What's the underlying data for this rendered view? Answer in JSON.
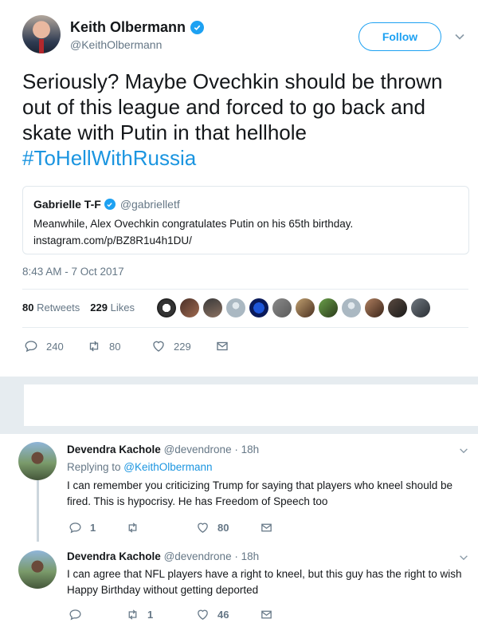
{
  "main_tweet": {
    "author_name": "Keith Olbermann",
    "author_handle": "@KeithOlbermann",
    "follow_label": "Follow",
    "text_lines": [
      "Seriously? Maybe Ovechkin should be thrown",
      "out of this league and forced to go back and",
      "skate with Putin in that hellhole"
    ],
    "hashtag": "#ToHellWithRussia",
    "quote": {
      "author_name": "Gabrielle T-F",
      "author_handle": "@gabrielletf",
      "text": "Meanwhile, Alex Ovechkin congratulates Putin on his 65th birthday.",
      "link": "instagram.com/p/BZ8R1u4h1DU/"
    },
    "timestamp": "8:43 AM - 7 Oct 2017",
    "retweets_count": "80",
    "retweets_label": "Retweets",
    "likes_count": "229",
    "likes_label": "Likes",
    "actions": {
      "replies": "240",
      "retweets": "80",
      "likes": "229"
    }
  },
  "replies": [
    {
      "author_name": "Devendra Kachole",
      "meta": "@devendrone · 18h",
      "replying_prefix": "Replying to ",
      "replying_to": "@KeithOlbermann",
      "text": "I can remember you criticizing Trump for saying that players who kneel should be fired. This is hypocrisy. He has Freedom of Speech too",
      "replies": "1",
      "retweets": "",
      "likes": "80"
    },
    {
      "author_name": "Devendra Kachole",
      "meta": "@devendrone · 18h",
      "text": "I can agree that NFL players have a right to kneel, but this guy has the right to wish Happy Birthday without getting deported",
      "replies": "",
      "retweets": "1",
      "likes": "46"
    }
  ],
  "colors": {
    "accent": "#1da1f2",
    "link": "#1b95e0",
    "muted": "#657786",
    "text": "#14171a",
    "divider": "#e6ecf0"
  },
  "icons": [
    "verified-badge-icon",
    "chevron-down-icon",
    "reply-icon",
    "retweet-icon",
    "like-icon",
    "message-icon"
  ]
}
